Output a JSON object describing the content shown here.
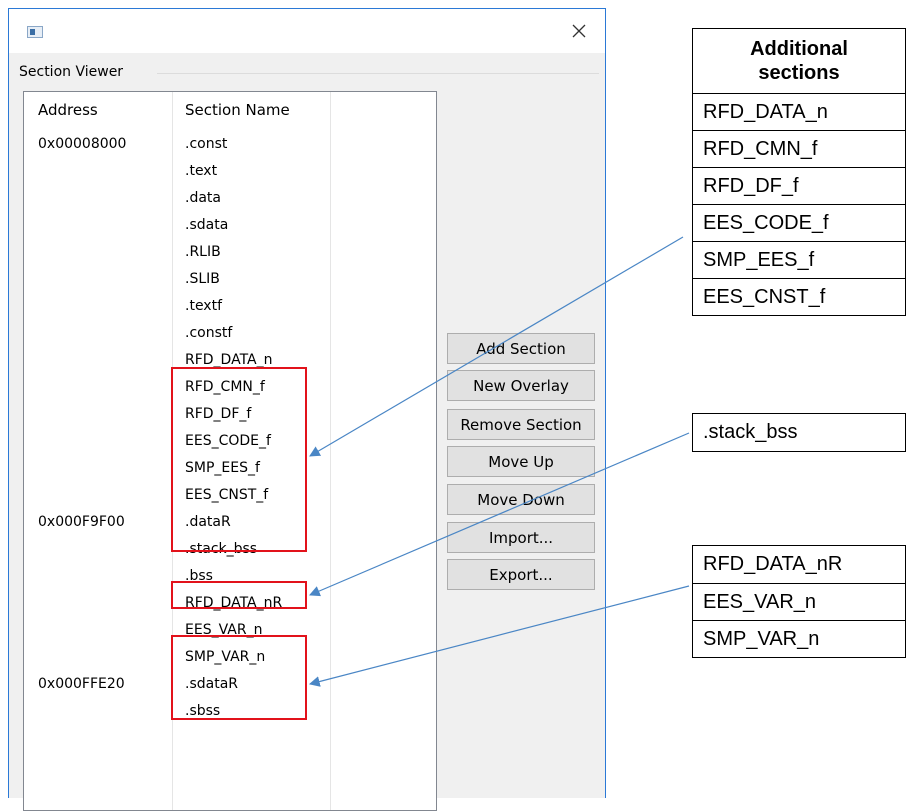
{
  "window": {
    "close_glyph": "✕",
    "group_title": "Section Viewer"
  },
  "list": {
    "columns": [
      "Address",
      "Section Name"
    ],
    "rows": [
      {
        "address": "0x00008000",
        "name": ".const"
      },
      {
        "address": "",
        "name": ".text"
      },
      {
        "address": "",
        "name": ".data"
      },
      {
        "address": "",
        "name": ".sdata"
      },
      {
        "address": "",
        "name": ".RLIB"
      },
      {
        "address": "",
        "name": ".SLIB"
      },
      {
        "address": "",
        "name": ".textf"
      },
      {
        "address": "",
        "name": ".constf"
      },
      {
        "address": "",
        "name": "RFD_DATA_n"
      },
      {
        "address": "",
        "name": "RFD_CMN_f"
      },
      {
        "address": "",
        "name": "RFD_DF_f"
      },
      {
        "address": "",
        "name": "EES_CODE_f"
      },
      {
        "address": "",
        "name": "SMP_EES_f"
      },
      {
        "address": "",
        "name": "EES_CNST_f"
      },
      {
        "address": "0x000F9F00",
        "name": ".dataR"
      },
      {
        "address": "",
        "name": ".stack_bss"
      },
      {
        "address": "",
        "name": ".bss"
      },
      {
        "address": "",
        "name": "RFD_DATA_nR"
      },
      {
        "address": "",
        "name": "EES_VAR_n"
      },
      {
        "address": "",
        "name": "SMP_VAR_n"
      },
      {
        "address": "0x000FFE20",
        "name": ".sdataR"
      },
      {
        "address": "",
        "name": ".sbss"
      }
    ]
  },
  "buttons": {
    "add_section": "Add Section",
    "new_overlay": "New Overlay",
    "remove_section": "Remove Section",
    "move_up": "Move Up",
    "move_down": "Move Down",
    "import": "Import...",
    "export": "Export..."
  },
  "annotations": {
    "additional_header_line1": "Additional",
    "additional_header_line2": "sections",
    "additional": [
      "RFD_DATA_n",
      "RFD_CMN_f",
      "RFD_DF_f",
      "EES_CODE_f",
      "SMP_EES_f",
      "EES_CNST_f"
    ],
    "stack": ".stack_bss",
    "ram": [
      "RFD_DATA_nR",
      "EES_VAR_n",
      "SMP_VAR_n"
    ]
  },
  "colors": {
    "highlight": "#e2121b",
    "arrow": "#4a86c5",
    "window_border": "#2b79d6"
  }
}
